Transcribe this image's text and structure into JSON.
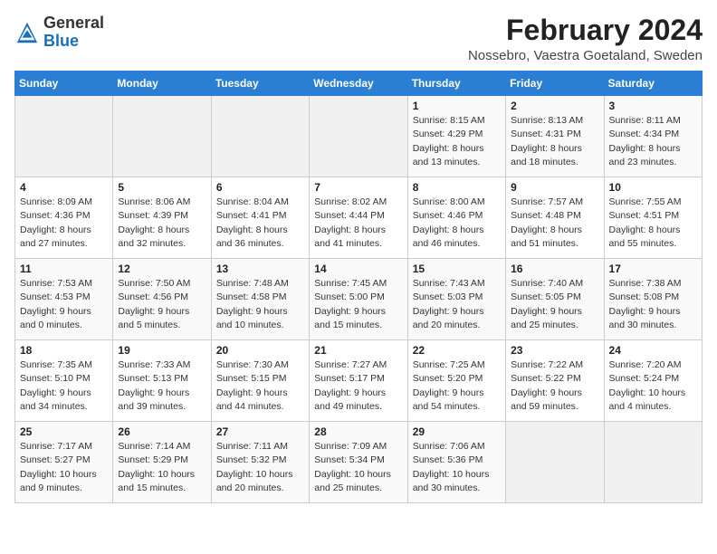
{
  "header": {
    "logo_general": "General",
    "logo_blue": "Blue",
    "month_year": "February 2024",
    "location": "Nossebro, Vaestra Goetaland, Sweden"
  },
  "weekdays": [
    "Sunday",
    "Monday",
    "Tuesday",
    "Wednesday",
    "Thursday",
    "Friday",
    "Saturday"
  ],
  "weeks": [
    [
      {
        "day": "",
        "info": ""
      },
      {
        "day": "",
        "info": ""
      },
      {
        "day": "",
        "info": ""
      },
      {
        "day": "",
        "info": ""
      },
      {
        "day": "1",
        "info": "Sunrise: 8:15 AM\nSunset: 4:29 PM\nDaylight: 8 hours\nand 13 minutes."
      },
      {
        "day": "2",
        "info": "Sunrise: 8:13 AM\nSunset: 4:31 PM\nDaylight: 8 hours\nand 18 minutes."
      },
      {
        "day": "3",
        "info": "Sunrise: 8:11 AM\nSunset: 4:34 PM\nDaylight: 8 hours\nand 23 minutes."
      }
    ],
    [
      {
        "day": "4",
        "info": "Sunrise: 8:09 AM\nSunset: 4:36 PM\nDaylight: 8 hours\nand 27 minutes."
      },
      {
        "day": "5",
        "info": "Sunrise: 8:06 AM\nSunset: 4:39 PM\nDaylight: 8 hours\nand 32 minutes."
      },
      {
        "day": "6",
        "info": "Sunrise: 8:04 AM\nSunset: 4:41 PM\nDaylight: 8 hours\nand 36 minutes."
      },
      {
        "day": "7",
        "info": "Sunrise: 8:02 AM\nSunset: 4:44 PM\nDaylight: 8 hours\nand 41 minutes."
      },
      {
        "day": "8",
        "info": "Sunrise: 8:00 AM\nSunset: 4:46 PM\nDaylight: 8 hours\nand 46 minutes."
      },
      {
        "day": "9",
        "info": "Sunrise: 7:57 AM\nSunset: 4:48 PM\nDaylight: 8 hours\nand 51 minutes."
      },
      {
        "day": "10",
        "info": "Sunrise: 7:55 AM\nSunset: 4:51 PM\nDaylight: 8 hours\nand 55 minutes."
      }
    ],
    [
      {
        "day": "11",
        "info": "Sunrise: 7:53 AM\nSunset: 4:53 PM\nDaylight: 9 hours\nand 0 minutes."
      },
      {
        "day": "12",
        "info": "Sunrise: 7:50 AM\nSunset: 4:56 PM\nDaylight: 9 hours\nand 5 minutes."
      },
      {
        "day": "13",
        "info": "Sunrise: 7:48 AM\nSunset: 4:58 PM\nDaylight: 9 hours\nand 10 minutes."
      },
      {
        "day": "14",
        "info": "Sunrise: 7:45 AM\nSunset: 5:00 PM\nDaylight: 9 hours\nand 15 minutes."
      },
      {
        "day": "15",
        "info": "Sunrise: 7:43 AM\nSunset: 5:03 PM\nDaylight: 9 hours\nand 20 minutes."
      },
      {
        "day": "16",
        "info": "Sunrise: 7:40 AM\nSunset: 5:05 PM\nDaylight: 9 hours\nand 25 minutes."
      },
      {
        "day": "17",
        "info": "Sunrise: 7:38 AM\nSunset: 5:08 PM\nDaylight: 9 hours\nand 30 minutes."
      }
    ],
    [
      {
        "day": "18",
        "info": "Sunrise: 7:35 AM\nSunset: 5:10 PM\nDaylight: 9 hours\nand 34 minutes."
      },
      {
        "day": "19",
        "info": "Sunrise: 7:33 AM\nSunset: 5:13 PM\nDaylight: 9 hours\nand 39 minutes."
      },
      {
        "day": "20",
        "info": "Sunrise: 7:30 AM\nSunset: 5:15 PM\nDaylight: 9 hours\nand 44 minutes."
      },
      {
        "day": "21",
        "info": "Sunrise: 7:27 AM\nSunset: 5:17 PM\nDaylight: 9 hours\nand 49 minutes."
      },
      {
        "day": "22",
        "info": "Sunrise: 7:25 AM\nSunset: 5:20 PM\nDaylight: 9 hours\nand 54 minutes."
      },
      {
        "day": "23",
        "info": "Sunrise: 7:22 AM\nSunset: 5:22 PM\nDaylight: 9 hours\nand 59 minutes."
      },
      {
        "day": "24",
        "info": "Sunrise: 7:20 AM\nSunset: 5:24 PM\nDaylight: 10 hours\nand 4 minutes."
      }
    ],
    [
      {
        "day": "25",
        "info": "Sunrise: 7:17 AM\nSunset: 5:27 PM\nDaylight: 10 hours\nand 9 minutes."
      },
      {
        "day": "26",
        "info": "Sunrise: 7:14 AM\nSunset: 5:29 PM\nDaylight: 10 hours\nand 15 minutes."
      },
      {
        "day": "27",
        "info": "Sunrise: 7:11 AM\nSunset: 5:32 PM\nDaylight: 10 hours\nand 20 minutes."
      },
      {
        "day": "28",
        "info": "Sunrise: 7:09 AM\nSunset: 5:34 PM\nDaylight: 10 hours\nand 25 minutes."
      },
      {
        "day": "29",
        "info": "Sunrise: 7:06 AM\nSunset: 5:36 PM\nDaylight: 10 hours\nand 30 minutes."
      },
      {
        "day": "",
        "info": ""
      },
      {
        "day": "",
        "info": ""
      }
    ]
  ]
}
